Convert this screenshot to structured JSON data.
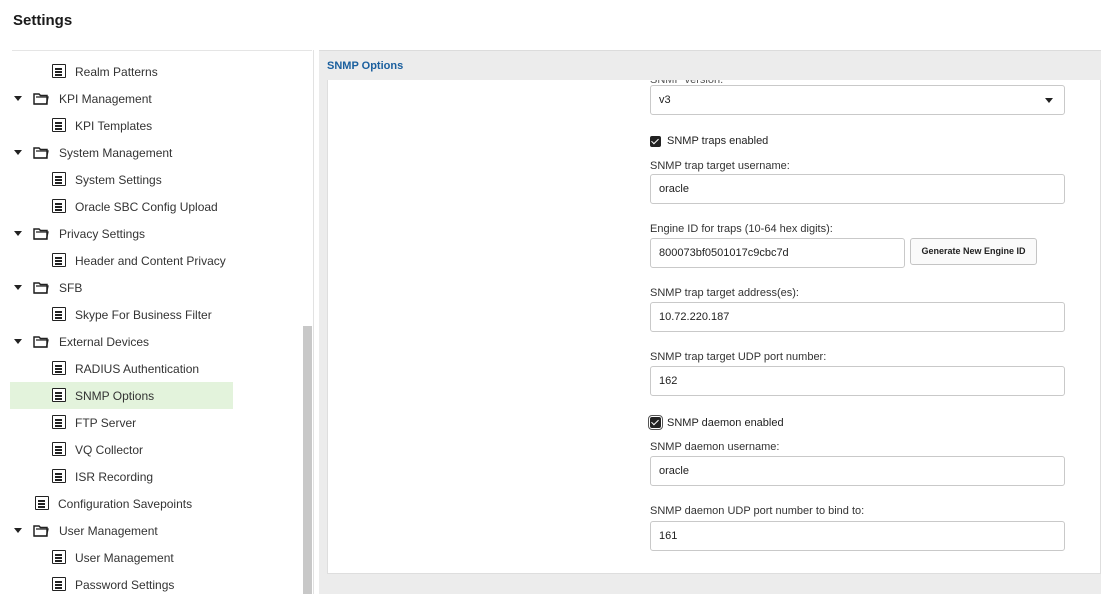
{
  "page": {
    "title": "Settings"
  },
  "sidebar": {
    "items": [
      {
        "label": "Realm Patterns",
        "kind": "doc",
        "icon": "document-icon"
      },
      {
        "label": "KPI Management",
        "kind": "folder",
        "icon": "folder-icon"
      },
      {
        "label": "KPI Templates",
        "kind": "doc",
        "icon": "document-icon"
      },
      {
        "label": "System Management",
        "kind": "folder",
        "icon": "folder-icon"
      },
      {
        "label": "System Settings",
        "kind": "doc",
        "icon": "document-icon"
      },
      {
        "label": "Oracle SBC Config Upload",
        "kind": "doc",
        "icon": "document-icon"
      },
      {
        "label": "Privacy Settings",
        "kind": "folder",
        "icon": "folder-icon"
      },
      {
        "label": "Header and Content Privacy",
        "kind": "doc",
        "icon": "document-icon"
      },
      {
        "label": "SFB",
        "kind": "folder",
        "icon": "folder-icon"
      },
      {
        "label": "Skype For Business Filter",
        "kind": "doc",
        "icon": "document-icon"
      },
      {
        "label": "External Devices",
        "kind": "folder",
        "icon": "folder-icon"
      },
      {
        "label": "RADIUS Authentication",
        "kind": "doc",
        "icon": "document-icon"
      },
      {
        "label": "SNMP Options",
        "kind": "doc",
        "icon": "document-icon",
        "selected": true
      },
      {
        "label": "FTP Server",
        "kind": "doc",
        "icon": "document-icon"
      },
      {
        "label": "VQ Collector",
        "kind": "doc",
        "icon": "document-icon"
      },
      {
        "label": "ISR Recording",
        "kind": "doc",
        "icon": "document-icon"
      },
      {
        "label": "Configuration Savepoints",
        "kind": "doc",
        "icon": "document-icon"
      },
      {
        "label": "User Management",
        "kind": "folder",
        "icon": "folder-icon"
      },
      {
        "label": "User Management",
        "kind": "doc",
        "icon": "document-icon"
      },
      {
        "label": "Password Settings",
        "kind": "doc",
        "icon": "document-icon"
      }
    ],
    "selected_color": "#e3f3dc"
  },
  "panel": {
    "title": "SNMP Options",
    "title_color": "#1a5f9e",
    "version_label": "SNMP version:",
    "version_value": "v3",
    "traps_enabled_label": "SNMP traps enabled",
    "trap_username_label": "SNMP trap target username:",
    "trap_username_value": "oracle",
    "engine_id_label": "Engine ID for traps (10-64 hex digits):",
    "engine_id_value": "800073bf0501017c9cbc7d",
    "generate_button": "Generate New Engine ID",
    "trap_address_label": "SNMP trap target address(es):",
    "trap_address_value": "10.72.220.187",
    "trap_port_label": "SNMP trap target UDP port number:",
    "trap_port_value": "162",
    "daemon_enabled_label": "SNMP daemon enabled",
    "daemon_username_label": "SNMP daemon username:",
    "daemon_username_value": "oracle",
    "daemon_port_label": "SNMP daemon UDP port number to bind to:",
    "daemon_port_value": "161"
  }
}
